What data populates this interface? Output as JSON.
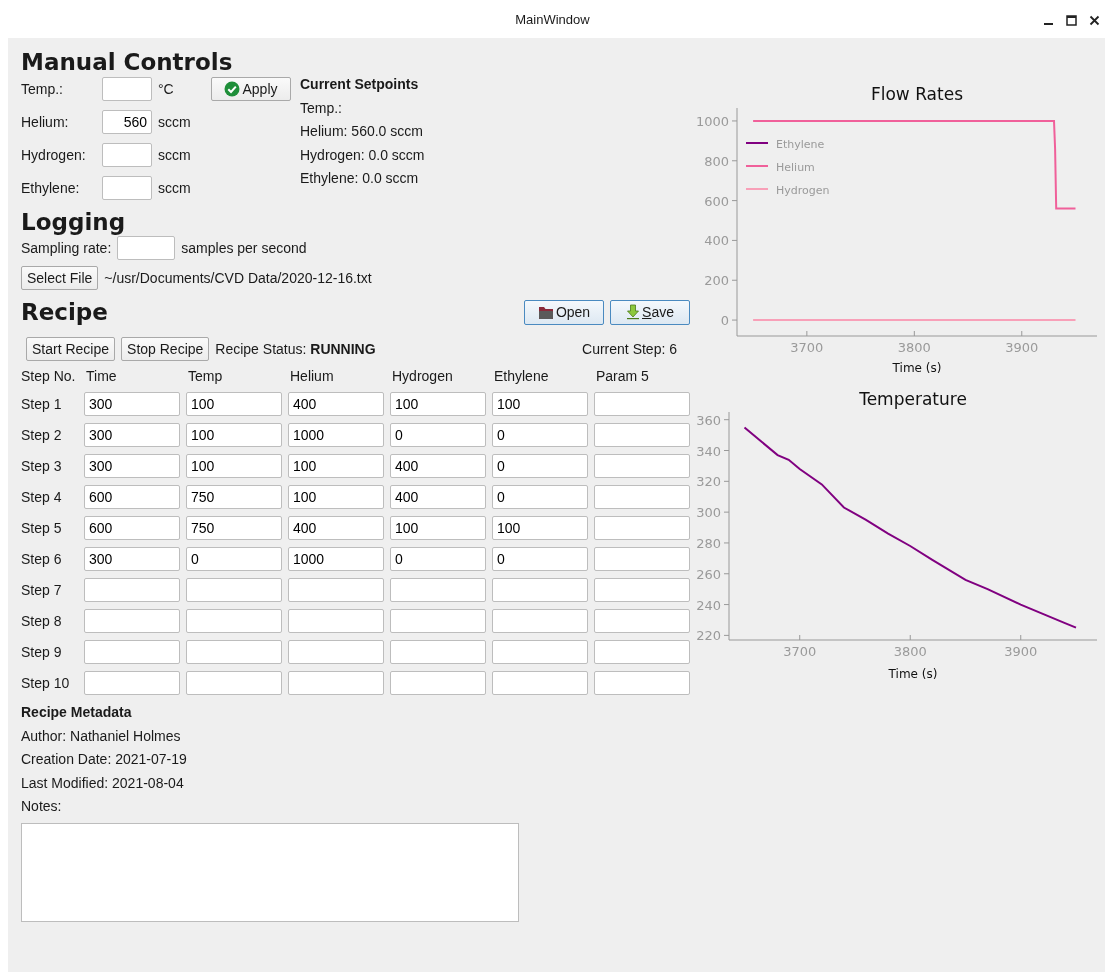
{
  "window": {
    "title": "MainWindow"
  },
  "manual_controls": {
    "heading": "Manual Controls",
    "fields": [
      {
        "label": "Temp.:",
        "unit": "°C"
      },
      {
        "label": "Helium:",
        "value": "560",
        "unit": "sccm"
      },
      {
        "label": "Hydrogen:",
        "unit": "sccm"
      },
      {
        "label": "Ethylene:",
        "unit": "sccm"
      }
    ],
    "apply_button": "Apply",
    "setpoints": {
      "heading": "Current Setpoints",
      "lines": [
        "Temp.:",
        "Helium: 560.0 sccm",
        "Hydrogen: 0.0 sccm",
        "Ethylene: 0.0 sccm"
      ]
    }
  },
  "logging": {
    "heading": "Logging",
    "sampling_label": "Sampling rate:",
    "sampling_unit": "samples per second",
    "select_file_button": "Select File",
    "file_path": "~/usr/Documents/CVD Data/2020-12-16.txt"
  },
  "recipe": {
    "heading": "Recipe",
    "open_button": "Open",
    "save_button": "Save",
    "start_button": "Start Recipe",
    "stop_button": "Stop Recipe",
    "status_label": "Recipe Status:",
    "status_value": "RUNNING",
    "current_step": "Current Step: 6",
    "columns": [
      "Step No.",
      "Time",
      "Temp",
      "Helium",
      "Hydrogen",
      "Ethylene",
      "Param 5"
    ],
    "rows": [
      {
        "label": "Step 1",
        "values": [
          "300",
          "100",
          "400",
          "100",
          "100"
        ]
      },
      {
        "label": "Step 2",
        "values": [
          "300",
          "100",
          "1000",
          "0",
          "0"
        ]
      },
      {
        "label": "Step 3",
        "values": [
          "300",
          "100",
          "100",
          "400",
          "0"
        ]
      },
      {
        "label": "Step 4",
        "values": [
          "600",
          "750",
          "100",
          "400",
          "0"
        ]
      },
      {
        "label": "Step 5",
        "values": [
          "600",
          "750",
          "400",
          "100",
          "100"
        ]
      },
      {
        "label": "Step 6",
        "values": [
          "300",
          "0",
          "1000",
          "0",
          "0"
        ]
      },
      {
        "label": "Step 7"
      },
      {
        "label": "Step 8"
      },
      {
        "label": "Step 9"
      },
      {
        "label": "Step 10"
      }
    ]
  },
  "metadata": {
    "heading": "Recipe Metadata",
    "lines": [
      "Author: Nathaniel Holmes",
      "Creation Date: 2021-07-19",
      "Last Modified: 2021-08-04"
    ],
    "notes_label": "Notes:"
  },
  "charts": [
    {
      "chart_data": {
        "type": "line",
        "title": "Flow Rates",
        "xlabel": "Time (s)",
        "x": [
          3650,
          3930,
          3931,
          3932,
          3950
        ],
        "series": [
          {
            "name": "Ethylene",
            "color": "#800080",
            "values": [
              null,
              null,
              null,
              null,
              null
            ]
          },
          {
            "name": "Helium",
            "color": "#f0609a",
            "values": [
              1000,
              1000,
              860,
              560,
              560
            ]
          },
          {
            "name": "Hydrogen",
            "color": "#f8a0b8",
            "values": [
              0,
              0,
              0,
              0,
              0
            ]
          }
        ],
        "legend": true,
        "xlim": [
          3635,
          3970
        ],
        "ylim": [
          -80,
          1065
        ],
        "xticks": [
          3700,
          3800,
          3900
        ],
        "yticks": [
          0,
          200,
          400,
          600,
          800,
          1000
        ]
      }
    },
    {
      "chart_data": {
        "type": "line",
        "title": "Temperature",
        "xlabel": "Time (s)",
        "x": [
          3650,
          3665,
          3680,
          3690,
          3700,
          3720,
          3740,
          3760,
          3780,
          3800,
          3820,
          3850,
          3870,
          3900,
          3920,
          3940,
          3950
        ],
        "series": [
          {
            "color": "#800080",
            "values": [
              355,
              346,
              337,
              334,
              328,
              318,
              303,
              295,
              286,
              278,
              269,
              256,
              250,
              240,
              234,
              228,
              225
            ]
          }
        ],
        "xlim": [
          3636,
          3969
        ],
        "ylim": [
          217,
          365
        ],
        "xticks": [
          3700,
          3800,
          3900
        ],
        "yticks": [
          220,
          240,
          260,
          280,
          300,
          320,
          340,
          360
        ]
      }
    }
  ]
}
